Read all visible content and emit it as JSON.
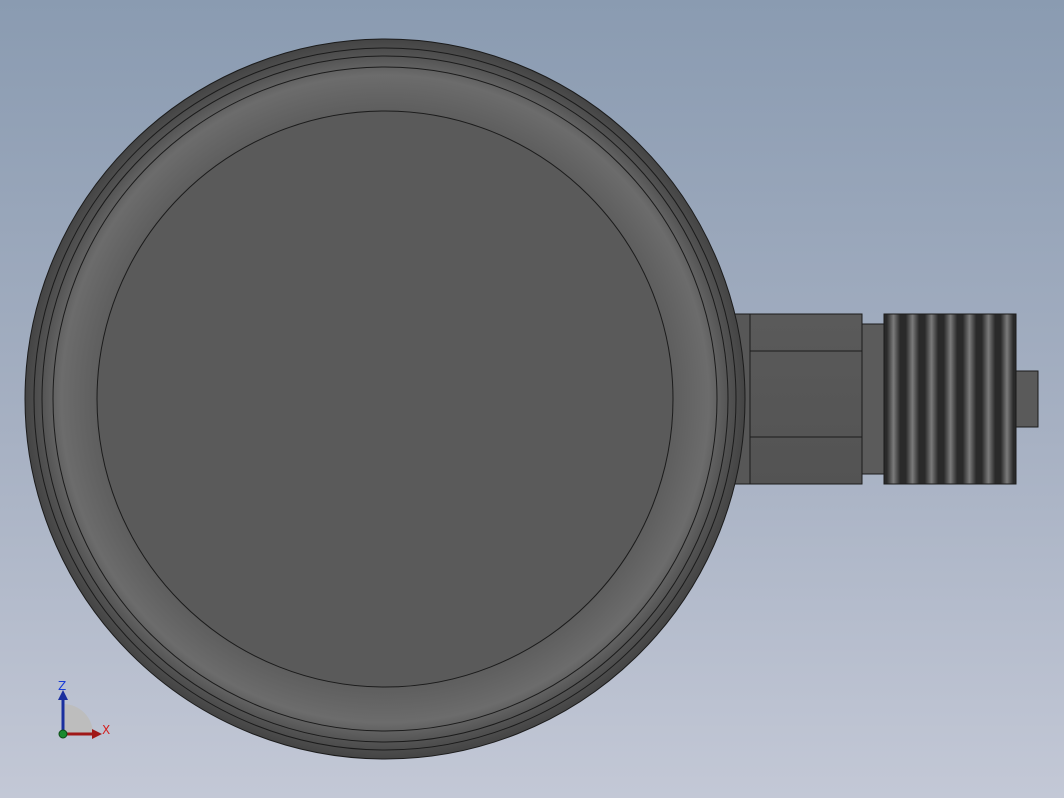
{
  "app": {
    "view": "cad-3d-viewport"
  },
  "model": {
    "part": "pressure-gauge",
    "colors": {
      "body": "#5a5a5a",
      "body_rim": "#4c4c4c",
      "edges": "#1b1b1b",
      "thread_dark": "#2b2b2b",
      "thread_light": "#7a7a7a",
      "fitting": "#555555"
    }
  },
  "triad": {
    "z_label": "Z",
    "x_label": "X",
    "z_color": "#1a3cd6",
    "x_color": "#d42020",
    "y_color": "#1b8a2e",
    "icon": "coordinate-triad-icon"
  }
}
